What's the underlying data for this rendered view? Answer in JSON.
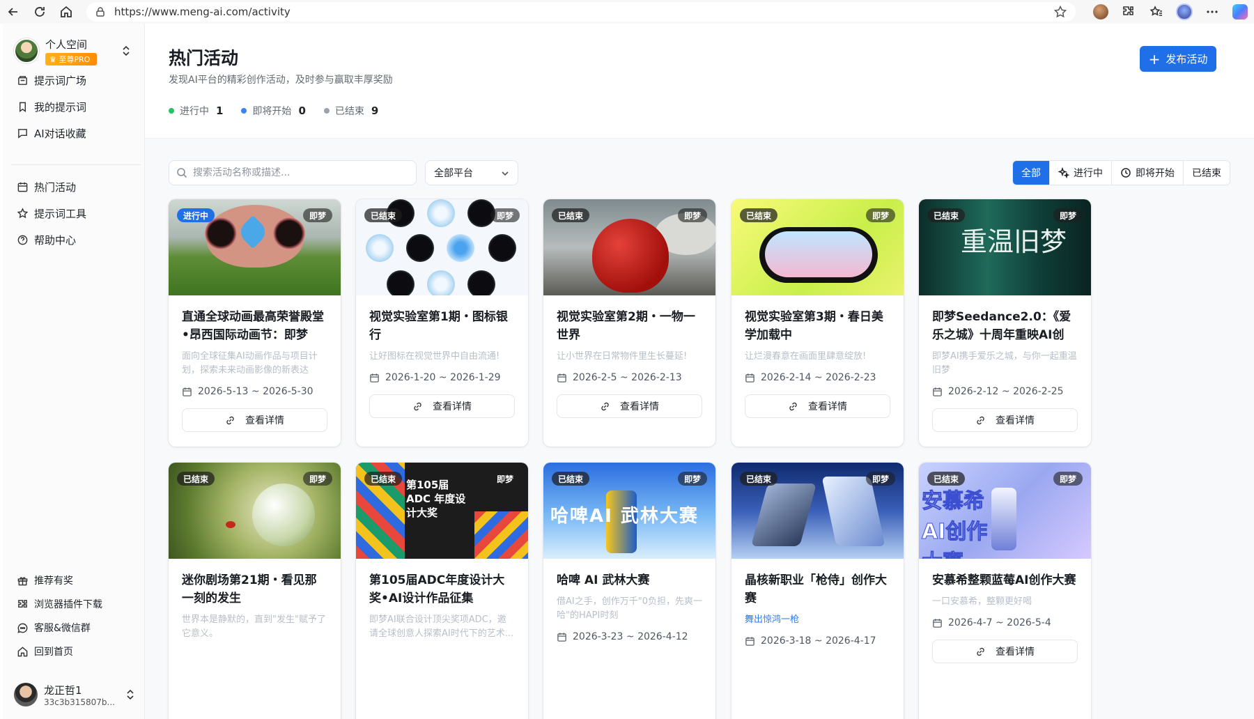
{
  "browser": {
    "url": "https://www.meng-ai.com/activity"
  },
  "sidebar": {
    "profile": {
      "name": "个人空间",
      "badge": "至尊PRO"
    },
    "nav_top": [
      {
        "label": "提示词广场",
        "icon": "book-icon"
      },
      {
        "label": "我的提示词",
        "icon": "bookmark-icon"
      },
      {
        "label": "AI对话收藏",
        "icon": "chat-icon"
      }
    ],
    "nav_mid": [
      {
        "label": "热门活动",
        "icon": "calendar-icon"
      },
      {
        "label": "提示词工具",
        "icon": "star-icon"
      },
      {
        "label": "帮助中心",
        "icon": "help-icon"
      }
    ],
    "nav_bottom": [
      {
        "label": "推荐有奖",
        "icon": "gift-icon"
      },
      {
        "label": "浏览器插件下载",
        "icon": "puzzle-icon"
      },
      {
        "label": "客服&微信群",
        "icon": "message-icon"
      },
      {
        "label": "回到首页",
        "icon": "home-icon"
      }
    ],
    "user": {
      "name": "龙正哲1",
      "id": "33c3b315807b..."
    }
  },
  "header": {
    "title": "热门活动",
    "subtitle": "发现AI平台的精彩创作活动，及时参与赢取丰厚奖励",
    "publish_label": "发布活动",
    "stats": [
      {
        "label": "进行中",
        "count": "1",
        "color": "#22c55e"
      },
      {
        "label": "即将开始",
        "count": "0",
        "color": "#3b82f6"
      },
      {
        "label": "已结束",
        "count": "9",
        "color": "#9ca3af"
      }
    ]
  },
  "toolbar": {
    "search_placeholder": "搜索活动名称或描述...",
    "platform_value": "全部平台",
    "filters": [
      "全部",
      "进行中",
      "即将开始",
      "已结束"
    ]
  },
  "common": {
    "detail_label": "查看详情"
  },
  "cards": [
    {
      "status": "进行中",
      "platform": "即梦",
      "title": "直通全球动画最高荣誉殿堂•昂西国际动画节：即梦设...",
      "desc": "面向全球征集AI动画作品与项目计划，探索未来动画影像的新表达",
      "date": "2026-5-13 ~ 2026-5-30"
    },
    {
      "status": "已结束",
      "platform": "即梦",
      "title": "视觉实验室第1期・图标银行",
      "desc": "让好图标在视觉世界中自由流通!",
      "date": "2026-1-20 ~ 2026-1-29"
    },
    {
      "status": "已结束",
      "platform": "即梦",
      "title": "视觉实验室第2期・一物一世界",
      "desc": "让小世界在日常物件里生长蔓延!",
      "date": "2026-2-5 ~ 2026-2-13"
    },
    {
      "status": "已结束",
      "platform": "即梦",
      "title": "视觉实验室第3期・春日美学加载中",
      "desc": "让烂漫春意在画面里肆意绽放!",
      "date": "2026-2-14 ~ 2026-2-23"
    },
    {
      "status": "已结束",
      "platform": "即梦",
      "title": "即梦Seedance2.0：《爱乐之城》十周年重映AI创意...",
      "desc": "即梦AI携手爱乐之城，与你一起重温旧梦",
      "date": "2026-2-12 ~ 2026-2-25",
      "art_text": "重温旧梦"
    },
    {
      "status": "已结束",
      "platform": "即梦",
      "title": "迷你剧场第21期・看见那一刻的发生",
      "desc": "世界本是静默的，直到\"发生\"赋予了它意义。",
      "date": ""
    },
    {
      "status": "已结束",
      "platform": "即梦",
      "title": "第105届ADC年度设计大奖•AI设计作品征集",
      "desc": "即梦AI联合设计顶尖奖项ADC，邀请全球创意人探索AI时代下的艺术...",
      "date": "",
      "art_text": "第105届ADC 年度设计大奖"
    },
    {
      "status": "已结束",
      "platform": "即梦",
      "title": "哈啤 AI 武林大赛",
      "desc": "借AI之手，创作万千\"0负担，先爽一哈\"的HAPI时刻",
      "date": "2026-3-23 ~ 2026-4-12",
      "art_text": "哈啤AI 武林大赛"
    },
    {
      "status": "已结束",
      "platform": "即梦",
      "title": "晶核新职业「枪侍」创作大赛",
      "desc": "舞出惊鸿一枪",
      "date": "2026-3-18 ~ 2026-4-17"
    },
    {
      "status": "已结束",
      "platform": "即梦",
      "title": "安慕希整颗蓝莓AI创作大赛",
      "desc": "一口安慕希，整颗更好喝",
      "date": "2026-4-7 ~ 2026-5-4",
      "art_text": "安慕希 AI创作大赛"
    }
  ]
}
